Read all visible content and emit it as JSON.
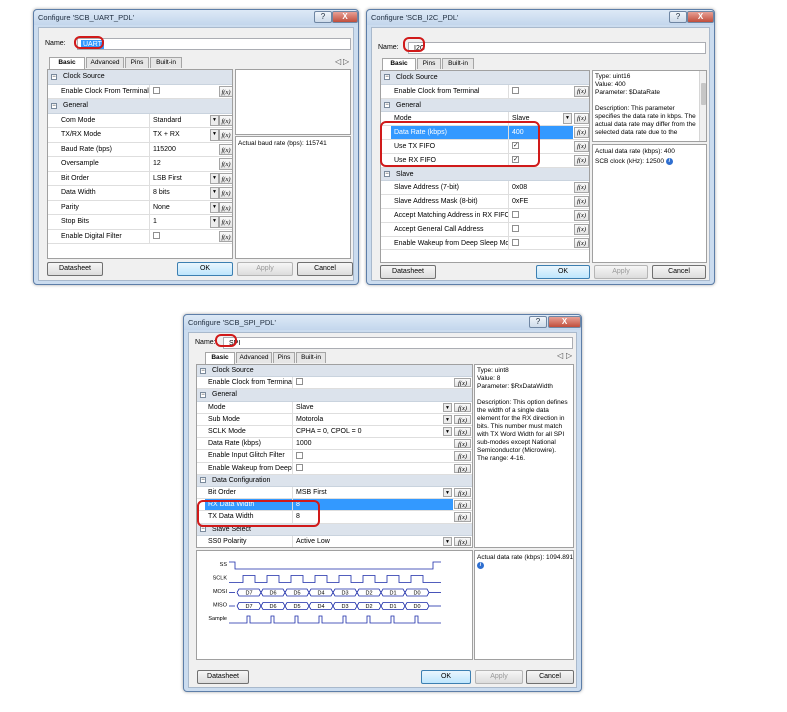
{
  "uart": {
    "title": "Configure 'SCB_UART_PDL'",
    "name_label": "Name:",
    "name_value": "UART",
    "tabs": [
      "Basic",
      "Advanced",
      "Pins",
      "Built-in"
    ],
    "rows": [
      {
        "type": "cat",
        "label": "Clock Source"
      },
      {
        "type": "param",
        "label": "Enable Clock From Terminal",
        "value": "",
        "checkbox": true,
        "checked": false
      },
      {
        "type": "cat",
        "label": "General"
      },
      {
        "type": "param",
        "label": "Com Mode",
        "value": "Standard",
        "dropdown": true
      },
      {
        "type": "param",
        "label": "TX/RX Mode",
        "value": "TX + RX",
        "dropdown": true
      },
      {
        "type": "param",
        "label": "Baud Rate (bps)",
        "value": "115200"
      },
      {
        "type": "param",
        "label": "Oversample",
        "value": "12"
      },
      {
        "type": "param",
        "label": "Bit Order",
        "value": "LSB First",
        "dropdown": true
      },
      {
        "type": "param",
        "label": "Data Width",
        "value": "8 bits",
        "dropdown": true
      },
      {
        "type": "param",
        "label": "Parity",
        "value": "None",
        "dropdown": true
      },
      {
        "type": "param",
        "label": "Stop Bits",
        "value": "1",
        "dropdown": true
      },
      {
        "type": "param",
        "label": "Enable Digital Filter",
        "value": "",
        "checkbox": true,
        "checked": false
      }
    ],
    "info_text": "Actual baud rate (bps): 115741",
    "buttons": {
      "datasheet": "Datasheet",
      "ok": "OK",
      "apply": "Apply",
      "cancel": "Cancel"
    }
  },
  "i2c": {
    "title": "Configure 'SCB_I2C_PDL'",
    "name_label": "Name:",
    "name_value": "I2C",
    "tabs": [
      "Basic",
      "Pins",
      "Built-in"
    ],
    "rows": [
      {
        "type": "cat",
        "label": "Clock Source"
      },
      {
        "type": "param",
        "label": "Enable Clock from Terminal",
        "value": "",
        "checkbox": true,
        "checked": false
      },
      {
        "type": "cat",
        "label": "General"
      },
      {
        "type": "param",
        "label": "Mode",
        "value": "Slave",
        "dropdown": true
      },
      {
        "type": "param",
        "label": "Data Rate (kbps)",
        "value": "400",
        "selected": true
      },
      {
        "type": "param",
        "label": "Use TX FIFO",
        "value": "",
        "checkbox": true,
        "checked": true
      },
      {
        "type": "param",
        "label": "Use RX FIFO",
        "value": "",
        "checkbox": true,
        "checked": true
      },
      {
        "type": "cat",
        "label": "Slave"
      },
      {
        "type": "param",
        "label": "Slave Address (7-bit)",
        "value": "0x08"
      },
      {
        "type": "param",
        "label": "Slave Address Mask (8-bit)",
        "value": "0xFE"
      },
      {
        "type": "param",
        "label": "Accept Matching Address in RX FIFO",
        "value": "",
        "checkbox": true,
        "checked": false
      },
      {
        "type": "param",
        "label": "Accept General Call Address",
        "value": "",
        "checkbox": true,
        "checked": false
      },
      {
        "type": "param",
        "label": "Enable Wakeup from Deep Sleep Mode",
        "value": "",
        "checkbox": true,
        "checked": false
      }
    ],
    "desc": "Type: uint16\nValue: 400\nParameter: $DataRate\n\nDescription: This parameter specifies the data rate in kbps. The actual data rate may differ from the selected data rate due to the",
    "info_line1": "Actual data rate (kbps): 400",
    "info_line2": "SCB clock (kHz): 12500",
    "buttons": {
      "datasheet": "Datasheet",
      "ok": "OK",
      "apply": "Apply",
      "cancel": "Cancel"
    }
  },
  "spi": {
    "title": "Configure 'SCB_SPI_PDL'",
    "name_label": "Name:",
    "name_value": "SPI",
    "tabs": [
      "Basic",
      "Advanced",
      "Pins",
      "Built-in"
    ],
    "rows": [
      {
        "type": "cat",
        "label": "Clock Source"
      },
      {
        "type": "param",
        "label": "Enable Clock from Terminal",
        "value": "",
        "checkbox": true,
        "checked": false
      },
      {
        "type": "cat",
        "label": "General"
      },
      {
        "type": "param",
        "label": "Mode",
        "value": "Slave",
        "dropdown": true
      },
      {
        "type": "param",
        "label": "Sub Mode",
        "value": "Motorola",
        "dropdown": true
      },
      {
        "type": "param",
        "label": "SCLK Mode",
        "value": "CPHA = 0, CPOL = 0",
        "dropdown": true
      },
      {
        "type": "param",
        "label": "Data Rate (kbps)",
        "value": "1000"
      },
      {
        "type": "param",
        "label": "Enable Input Glitch Filter",
        "value": "",
        "checkbox": true,
        "checked": false
      },
      {
        "type": "param",
        "label": "Enable Wakeup from DeepSleep",
        "value": "",
        "checkbox": true,
        "checked": false
      },
      {
        "type": "cat",
        "label": "Data Configuration"
      },
      {
        "type": "param",
        "label": "Bit Order",
        "value": "MSB First",
        "dropdown": true
      },
      {
        "type": "param",
        "label": "RX Data Width",
        "value": "8",
        "selected": true
      },
      {
        "type": "param",
        "label": "TX Data Width",
        "value": "8"
      },
      {
        "type": "cat",
        "label": "Slave Select"
      },
      {
        "type": "param",
        "label": "SS0 Polarity",
        "value": "Active Low",
        "dropdown": true
      }
    ],
    "desc": "Type: uint8\nValue: 8\nParameter: $RxDataWidth\n\nDescription: This option defines the width of a single data element for the RX direction in bits. This number must match with TX Word Width for all SPI sub-modes except National Semiconductor (Microwire).\nThe range: 4-16.",
    "info_text": "Actual data rate (kbps): 1094.891",
    "waveform": {
      "signals": [
        "SS",
        "SCLK",
        "MOSI",
        "MISO",
        "Sample"
      ],
      "bits": [
        "D7",
        "D6",
        "D5",
        "D4",
        "D3",
        "D2",
        "D1",
        "D0"
      ]
    },
    "buttons": {
      "datasheet": "Datasheet",
      "ok": "OK",
      "apply": "Apply",
      "cancel": "Cancel"
    }
  },
  "icons": {
    "help": "?",
    "close": "X",
    "fx": "f(x)",
    "nav_left": "◁",
    "nav_right": "▷",
    "dropdown": "▼",
    "info": "i",
    "check": "✓",
    "collapse": "−"
  },
  "colors": {
    "selection": "#3399ff",
    "annotation": "#d01a1a",
    "category": "#dce3ec",
    "frame": "#cbdcef"
  }
}
